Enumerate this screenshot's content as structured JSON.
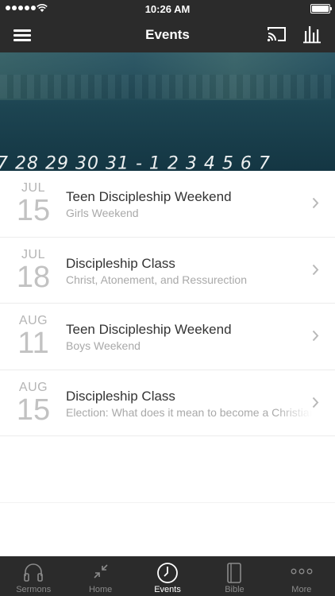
{
  "status_bar": {
    "time": "10:26 AM"
  },
  "header": {
    "title": "Events"
  },
  "hero": {
    "dates_text": "7  28  29  30  31 - 1   2   3   4   5   6   7"
  },
  "events": [
    {
      "month": "JUL",
      "day": "15",
      "title": "Teen Discipleship Weekend",
      "subtitle": "Girls Weekend"
    },
    {
      "month": "JUL",
      "day": "18",
      "title": "Discipleship Class",
      "subtitle": "Christ, Atonement, and Ressurection"
    },
    {
      "month": "AUG",
      "day": "11",
      "title": "Teen Discipleship Weekend",
      "subtitle": "Boys Weekend"
    },
    {
      "month": "AUG",
      "day": "15",
      "title": "Discipleship Class",
      "subtitle": "Election: What does it mean to become a Christian"
    }
  ],
  "tabs": [
    {
      "label": "Sermons",
      "icon": "headphones-icon",
      "active": false
    },
    {
      "label": "Home",
      "icon": "collapse-arrows-icon",
      "active": false
    },
    {
      "label": "Events",
      "icon": "clock-icon",
      "active": true
    },
    {
      "label": "Bible",
      "icon": "book-icon",
      "active": false
    },
    {
      "label": "More",
      "icon": "more-dots-icon",
      "active": false
    }
  ],
  "colors": {
    "bar_background": "#2b2b2b",
    "hero_teal": "#1d4552",
    "muted_text": "#a9a9a9"
  }
}
